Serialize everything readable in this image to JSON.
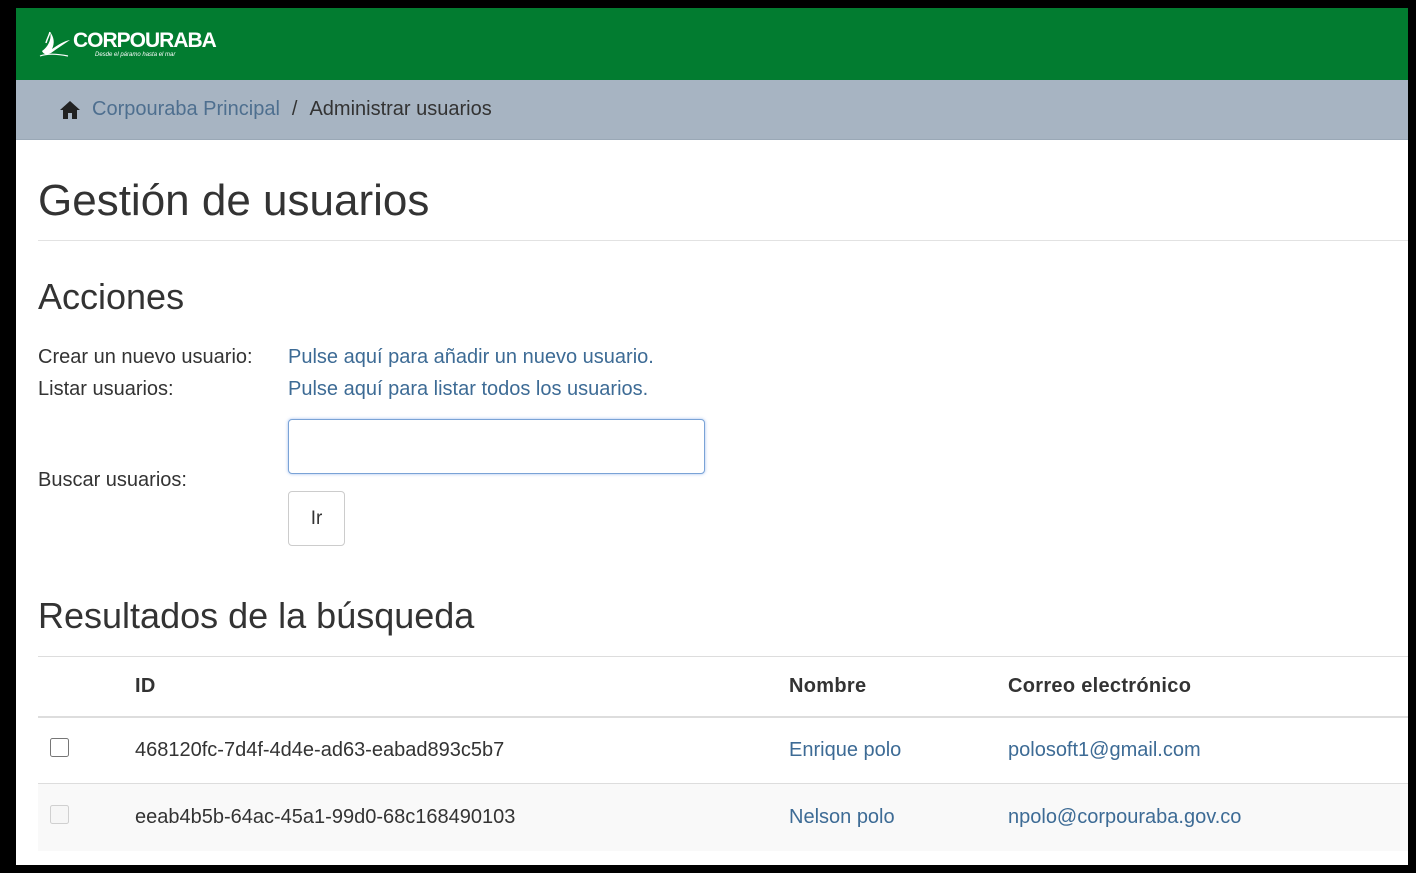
{
  "header": {
    "logo_text": "CORPOURABA",
    "logo_tagline": "Desde el páramo hasta el mar",
    "brand_color": "#027c30"
  },
  "breadcrumb": {
    "home_icon": "home-icon",
    "home_label": "Corpouraba Principal",
    "separator": "/",
    "current": "Administrar usuarios"
  },
  "page": {
    "title": "Gestión de usuarios"
  },
  "actions": {
    "heading": "Acciones",
    "create_label": "Crear un nuevo usuario:",
    "create_link": "Pulse aquí para añadir un nuevo usuario.",
    "list_label": "Listar usuarios:",
    "list_link": "Pulse aquí para listar todos los usuarios.",
    "search_label": "Buscar usuarios:",
    "search_value": "",
    "search_button": "Ir"
  },
  "results": {
    "heading": "Resultados de la búsqueda",
    "columns": [
      "",
      "ID",
      "Nombre",
      "Correo electrónico"
    ],
    "rows": [
      {
        "id": "468120fc-7d4f-4d4e-ad63-eabad893c5b7",
        "name": "Enrique polo",
        "email": "polosoft1@gmail.com",
        "checkbox_enabled": true
      },
      {
        "id": "eeab4b5b-64ac-45a1-99d0-68c168490103",
        "name": "Nelson polo",
        "email": "npolo@corpouraba.gov.co",
        "checkbox_enabled": false
      }
    ]
  }
}
